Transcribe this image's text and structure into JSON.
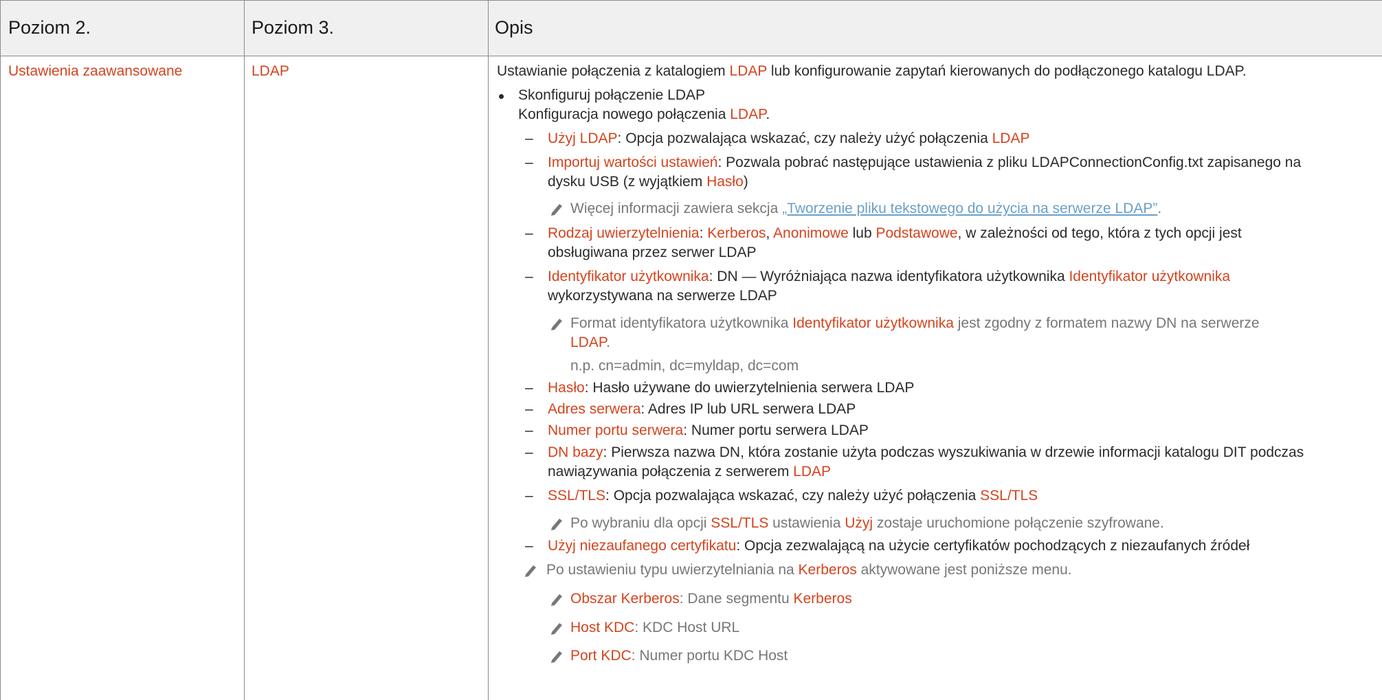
{
  "header": {
    "col1": "Poziom 2.",
    "col2": "Poziom 3.",
    "col3": "Opis"
  },
  "row": {
    "level2": "Ustawienia zaawansowane",
    "level3": "LDAP"
  },
  "desc": {
    "intro_a": "Ustawianie połączenia z katalogiem ",
    "intro_b": "LDAP",
    "intro_c": " lub konfigurowanie zapytań kierowanych do podłączonego katalogu LDAP.",
    "bullet_title": "Skonfiguruj połączenie LDAP",
    "bullet_sub_a": "Konfiguracja nowego połączenia ",
    "bullet_sub_b": "LDAP",
    "bullet_sub_c": ".",
    "uzyj_ldap_k": "Użyj LDAP",
    "uzyj_ldap_v": ": Opcja pozwalająca wskazać, czy należy użyć połączenia ",
    "uzyj_ldap_v2": "LDAP",
    "import_k": "Importuj wartości ustawień",
    "import_v1": ": Pozwala pobrać następujące ustawienia z pliku LDAPConnectionConfig.txt zapisanego na",
    "import_v2a": "dysku USB (z wyjątkiem ",
    "import_v2b": "Hasło",
    "import_v2c": ")",
    "note1_a": "Więcej informacji zawiera sekcja ",
    "note1_link": "„Tworzenie pliku tekstowego do użycia na serwerze LDAP”",
    "note1_c": ".",
    "auth_k": "Rodzaj uwierzytelnienia",
    "auth_v1": ": ",
    "auth_kerb": "Kerberos",
    "auth_sep1": ", ",
    "auth_anon": "Anonimowe",
    "auth_lub": " lub ",
    "auth_basic": "Podstawowe",
    "auth_v2": ", w zależności od tego, która z tych opcji jest",
    "auth_v3": "obsługiwana przez serwer LDAP",
    "uid_k": "Identyfikator użytkownika",
    "uid_v1": ": DN — Wyróżniająca nazwa identyfikatora użytkownika ",
    "uid_k2": "Identyfikator użytkownika",
    "uid_v2": "wykorzystywana na serwerze LDAP",
    "note2_a": "Format identyfikatora użytkownika ",
    "note2_b": "Identyfikator użytkownika",
    "note2_c": " jest zgodny z formatem nazwy DN na serwerze",
    "note2_d": "LDAP",
    "note2_e": ".",
    "note2_example": "n.p. cn=admin, dc=myldap, dc=com",
    "pass_k": "Hasło",
    "pass_v": ": Hasło używane do uwierzytelnienia serwera LDAP",
    "addr_k": "Adres serwera",
    "addr_v": ": Adres IP lub URL serwera LDAP",
    "port_k": "Numer portu serwera",
    "port_v": ": Numer portu serwera LDAP",
    "dn_k": "DN bazy",
    "dn_v1": ": Pierwsza nazwa DN, która zostanie użyta podczas wyszukiwania w drzewie informacji katalogu DIT podczas",
    "dn_v2a": "nawiązywania połączenia z serwerem ",
    "dn_v2b": "LDAP",
    "ssl_k": "SSL/TLS",
    "ssl_v": ": Opcja pozwalająca wskazać, czy należy użyć połączenia ",
    "ssl_v2": "SSL/TLS",
    "note3_a": "Po wybraniu dla opcji ",
    "note3_b": "SSL/TLS",
    "note3_c": " ustawienia ",
    "note3_d": "Użyj",
    "note3_e": " zostaje uruchomione połączenie szyfrowane.",
    "cert_k": "Użyj niezaufanego certyfikatu",
    "cert_v": ": Opcja zezwalającą na użycie certyfikatów pochodzących z niezaufanych źródeł",
    "note4_a": "Po ustawieniu typu uwierzytelniania na ",
    "note4_b": "Kerberos",
    "note4_c": " aktywowane jest poniższe menu.",
    "realm_k": "Obszar Kerberos",
    "realm_v": ": Dane segmentu ",
    "realm_v2": "Kerberos",
    "kdc_k": "Host KDC",
    "kdc_v": ": KDC Host URL",
    "kdcport_k": "Port KDC",
    "kdcport_v": ": Numer portu KDC Host"
  },
  "colors": {
    "accent": "#d4441e",
    "header_bg": "#f0f0f0",
    "border": "#8a8a8a",
    "note": "#777777",
    "link": "#6a9fc9"
  },
  "icons": [
    "pencil-icon"
  ]
}
